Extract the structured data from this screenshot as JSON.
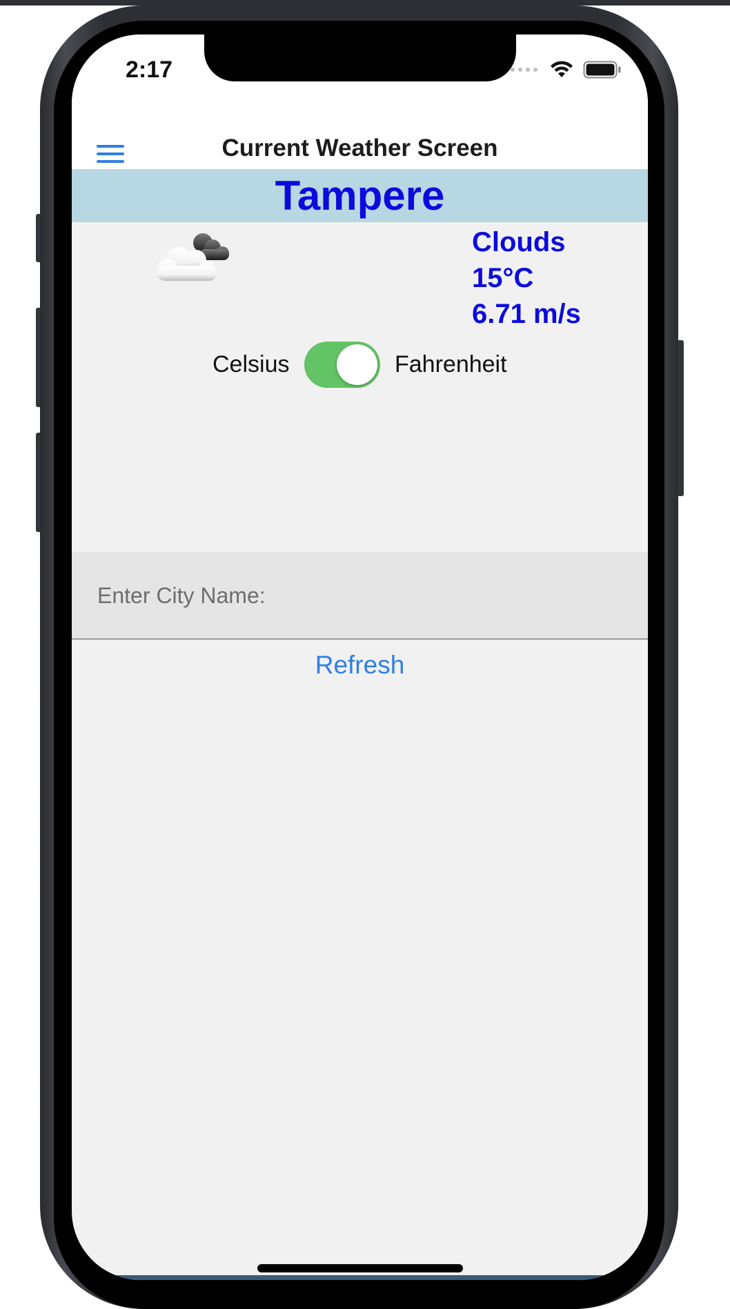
{
  "status_bar": {
    "time": "2:17",
    "icons": [
      "cellular-dots-icon",
      "wifi-icon",
      "battery-icon"
    ]
  },
  "header": {
    "menu_icon": "hamburger-menu-icon",
    "title": "Current Weather Screen"
  },
  "weather": {
    "city": "Tampere",
    "icon": "cloud-icon",
    "condition": "Clouds",
    "temperature": "15°C",
    "wind": "6.71 m/s"
  },
  "units": {
    "left_label": "Celsius",
    "right_label": "Fahrenheit",
    "toggle_on": true
  },
  "city_input": {
    "placeholder": "Enter City Name:",
    "value": ""
  },
  "refresh_label": "Refresh",
  "colors": {
    "accent_blue": "#2f7fe0",
    "weather_text": "#0b0bdc",
    "banner_bg": "#b7d7e3",
    "toggle_green": "#63c465"
  }
}
